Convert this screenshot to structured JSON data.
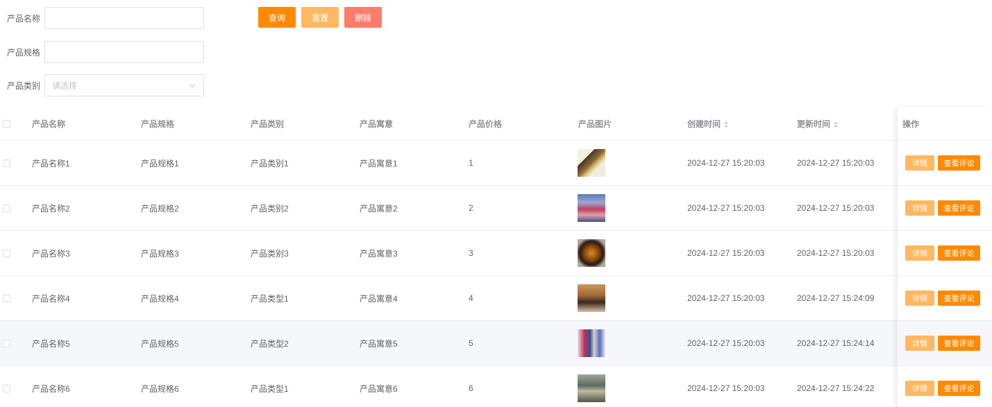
{
  "search": {
    "fields": [
      {
        "label": "产品名称",
        "value": "",
        "placeholder": ""
      },
      {
        "label": "产品规格",
        "value": "",
        "placeholder": ""
      }
    ],
    "category": {
      "label": "产品类别",
      "placeholder": "请选择"
    },
    "buttons": {
      "query": "查询",
      "reset": "重置",
      "delete": "删除"
    }
  },
  "colors": {
    "query_btn": "#ff8a00",
    "reset_btn": "#ffb862",
    "delete_btn": "#ff7b6b",
    "detail_btn": "#ffb862",
    "comments_btn": "#ff8a00"
  },
  "table": {
    "headers": [
      "产品名称",
      "产品规格",
      "产品类别",
      "产品寓意",
      "产品价格",
      "产品图片",
      "创建时间",
      "更新时间",
      "操作"
    ],
    "action_labels": {
      "detail": "详情",
      "comments": "查看评论"
    },
    "rows": [
      {
        "name": "产品名称1",
        "spec": "产品规格1",
        "category": "产品类别1",
        "meaning": "产品寓意1",
        "price": "1",
        "created": "2024-12-27 15:20:03",
        "updated": "2024-12-27 15:20:03",
        "image_icon": "product-photo-1"
      },
      {
        "name": "产品名称2",
        "spec": "产品规格2",
        "category": "产品类别2",
        "meaning": "产品寓意2",
        "price": "2",
        "created": "2024-12-27 15:20:03",
        "updated": "2024-12-27 15:20:03",
        "image_icon": "product-photo-2"
      },
      {
        "name": "产品名称3",
        "spec": "产品规格3",
        "category": "产品类别3",
        "meaning": "产品寓意3",
        "price": "3",
        "created": "2024-12-27 15:20:03",
        "updated": "2024-12-27 15:20:03",
        "image_icon": "product-photo-3"
      },
      {
        "name": "产品名称4",
        "spec": "产品规格4",
        "category": "产品类型1",
        "meaning": "产品寓意4",
        "price": "4",
        "created": "2024-12-27 15:20:03",
        "updated": "2024-12-27 15:24:09",
        "image_icon": "product-photo-4"
      },
      {
        "name": "产品名称5",
        "spec": "产品规格5",
        "category": "产品类型2",
        "meaning": "产品寓意5",
        "price": "5",
        "created": "2024-12-27 15:20:03",
        "updated": "2024-12-27 15:24:14",
        "image_icon": "product-photo-5"
      },
      {
        "name": "产品名称6",
        "spec": "产品规格6",
        "category": "产品类型1",
        "meaning": "产品寓意6",
        "price": "6",
        "created": "2024-12-27 15:20:03",
        "updated": "2024-12-27 15:24:22",
        "image_icon": "product-photo-6"
      }
    ]
  }
}
